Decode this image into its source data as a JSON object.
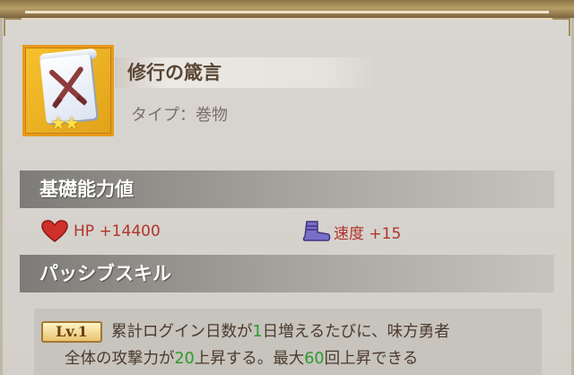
{
  "item": {
    "name": "修行の箴言",
    "type_label": "タイプ：巻物",
    "icon": "scroll-swords-icon",
    "stars": "★★"
  },
  "sections": {
    "base_stats": "基礎能力値",
    "passive": "パッシブスキル"
  },
  "stats": [
    {
      "icon": "heart-icon",
      "label": "HP +14400"
    },
    {
      "icon": "boot-icon",
      "label": "速度 +15"
    }
  ],
  "passive_skill": {
    "level": "Lv.1",
    "line1_a": "累計ログイン日数が",
    "line1_num": "1",
    "line1_b": "日増えるたびに、味方勇者",
    "line2_a": "全体の攻撃力が",
    "line2_num1": "20",
    "line2_b": "上昇する。最大",
    "line2_num2": "60",
    "line2_c": "回上昇できる"
  },
  "colors": {
    "stat_text": "#b2342a",
    "highlight_number": "#2d9a2d",
    "icon_frame": "#e89a1b"
  }
}
